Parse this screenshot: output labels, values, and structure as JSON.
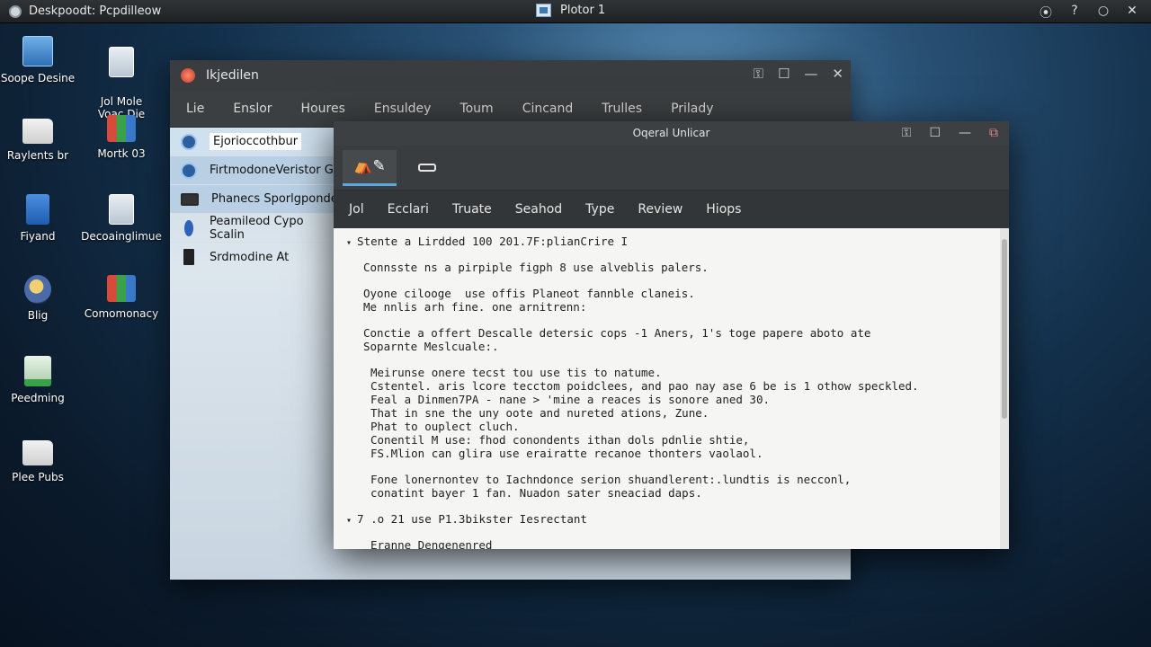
{
  "topbar": {
    "app_title": "Deskpoodt: Pcpdilleow",
    "center_title": "Plotor 1",
    "controls": [
      "⦿",
      "?",
      "○",
      "✕"
    ]
  },
  "desktop_icons": [
    {
      "label": "Soope Desine",
      "icon": "blue-tile-icon"
    },
    {
      "label": "Jol Mole\nVoac Die",
      "icon": "document-icon"
    },
    {
      "label": "Raylents br",
      "icon": "folder-icon"
    },
    {
      "label": "Mortk 03",
      "icon": "computer-icon"
    },
    {
      "label": "Fiyand",
      "icon": "blue-document-icon"
    },
    {
      "label": "Decoainglimue",
      "icon": "printer-icon"
    },
    {
      "label": "Blig",
      "icon": "shield-icon"
    },
    {
      "label": "Comomonacy",
      "icon": "apps-icon"
    },
    {
      "label": "Peedming",
      "icon": "installer-icon"
    },
    {
      "label": "Plee Pubs",
      "icon": "folder-icon"
    }
  ],
  "back_window": {
    "title": "Ikjedilen",
    "menu": [
      "Lie",
      "Enslor",
      "Houres",
      "Ensuldey",
      "Toum",
      "Cincand",
      "Trulles",
      "Prilady"
    ],
    "sidebar": [
      "Ejorioccothbur",
      "FirtmodoneVeristor G",
      "Phanecs Sporlgponde",
      "Peamileod Cypo Scalin",
      "Srdmodine At"
    ]
  },
  "front_window": {
    "title": "Oqeral Unlicar",
    "menu": [
      "Jol",
      "Ecclari",
      "Truate",
      "Seahod",
      "Type",
      "Review",
      "Hiops"
    ],
    "lines": [
      "Stente a Lirdded 100 201.7F:plianCrire I",
      "Connsste ns a pirpiple figph 8 use alveblis palers.",
      "Oyone cilooge  use offis Planeot fannble claneis.",
      "Me nnlis arh fine. one arnitrenn:",
      "Conctie a offert Descalle detersic cops -1 Aners, 1's toge papere aboto ate",
      "Soparnte Meslcuale:.",
      "Meirunse onere tecst tou use tis to natume.",
      "Cstentel. aris lcore tecctom poidclees, and pao nay ase 6 be is 1 othow speckled.",
      "Feal a Dinmen7PA - nane > 'mine a reaces is sonore aned 30.",
      "That in sne the uny oote and nureted ations, Zune.",
      "Phat to ouplect cluch.",
      "Conentil M use: fhod conondents ithan dols pdnlie shtie,",
      "FS.Mlion can glira use erairatte recanoe thonters vaolaol.",
      "Fone lonernontev to Iachndonce serion shuandlerent:.lundtis is necconl,",
      "conatint bayer 1 fan. Nuadon sater sneaciad daps.",
      "7 .o 21 use P1.3bikster Iesrectant",
      "Eranne Dengenenred"
    ]
  }
}
